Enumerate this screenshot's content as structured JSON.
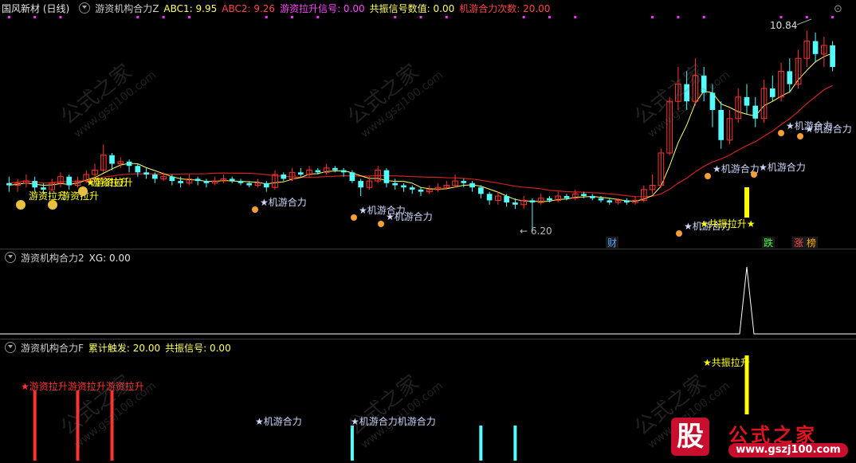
{
  "colors": {
    "up": "#ff3232",
    "down": "#54fcfc",
    "ma5": "#ffff66",
    "ma20": "#cc2222",
    "label_white": "#cfd8ff",
    "label_yellow": "#ffff00",
    "label_red": "#ff3232",
    "magenta": "#ff33ff"
  },
  "main": {
    "stock": "国风新材 (日线)",
    "indicator": "游资机构合力Z",
    "abc1_label": "ABC1: 9.95",
    "abc2_label": "ABC2: 9.26",
    "pull_signal": "游资拉升信号: 0.00",
    "resonance_value": "共振信号数值: 0.00",
    "fund_count": "机游合力次数: 20.00",
    "high_label": "10.84",
    "low_label": "6.20",
    "event_cai": "财",
    "event_die": "跌",
    "event_zhang": "涨",
    "event_bang": "榜",
    "marker_youzi": "游资拉升",
    "marker_jiyou": "★机游合力",
    "marker_gongzhen": "★共振拉升★",
    "marker_youzi_star": "★游资拉升"
  },
  "xg": {
    "indicator": "游资机构合力2",
    "value_label": "XG: 0.00"
  },
  "f": {
    "indicator": "游资机构合力F",
    "cum_label": "累计触发: 20.00",
    "res_label": "共振信号: 0.00",
    "bar_red_label": "★游资拉升游资拉升游资拉升",
    "bar_cyan_label1": "★机游合力",
    "bar_cyan_label2": "★机游合力机游合力",
    "bar_yellow_label": "★共振拉升"
  },
  "watermark": {
    "text": "公式之家",
    "url": "www.gszj100.com"
  },
  "logo": {
    "badge": "股",
    "name": "公式之家",
    "url": "www.gszj100.com"
  },
  "chart_data": {
    "type": "candlestick",
    "ylim": [
      6.0,
      11.0
    ],
    "high_label": 10.84,
    "low_label": 6.2,
    "candles": [
      [
        7.3,
        7.25,
        7.45,
        7.1
      ],
      [
        7.25,
        7.3,
        7.4,
        7.1
      ],
      [
        7.3,
        7.35,
        7.5,
        7.2
      ],
      [
        7.35,
        7.2,
        7.45,
        7.1
      ],
      [
        7.2,
        7.15,
        7.3,
        7.05
      ],
      [
        7.15,
        7.3,
        7.4,
        7.1
      ],
      [
        7.3,
        7.45,
        7.55,
        7.2
      ],
      [
        7.45,
        7.25,
        7.5,
        7.15
      ],
      [
        7.25,
        7.35,
        7.45,
        7.2
      ],
      [
        7.35,
        7.5,
        7.6,
        7.3
      ],
      [
        7.5,
        7.6,
        7.75,
        7.4
      ],
      [
        7.6,
        7.95,
        8.2,
        7.55
      ],
      [
        7.95,
        7.75,
        8.0,
        7.6
      ],
      [
        7.75,
        7.8,
        7.9,
        7.65
      ],
      [
        7.8,
        7.7,
        7.85,
        7.55
      ],
      [
        7.7,
        7.55,
        7.75,
        7.45
      ],
      [
        7.55,
        7.5,
        7.65,
        7.4
      ],
      [
        7.5,
        7.4,
        7.55,
        7.3
      ],
      [
        7.4,
        7.45,
        7.55,
        7.35
      ],
      [
        7.45,
        7.35,
        7.5,
        7.25
      ],
      [
        7.35,
        7.3,
        7.45,
        7.2
      ],
      [
        7.3,
        7.4,
        7.5,
        7.25
      ],
      [
        7.4,
        7.35,
        7.45,
        7.25
      ],
      [
        7.35,
        7.3,
        7.4,
        7.2
      ],
      [
        7.3,
        7.35,
        7.45,
        7.25
      ],
      [
        7.35,
        7.4,
        7.5,
        7.3
      ],
      [
        7.4,
        7.35,
        7.45,
        7.3
      ],
      [
        7.35,
        7.3,
        7.4,
        7.25
      ],
      [
        7.3,
        7.25,
        7.35,
        7.2
      ],
      [
        7.25,
        7.3,
        7.4,
        7.2
      ],
      [
        7.3,
        7.2,
        7.35,
        7.1
      ],
      [
        7.2,
        7.5,
        7.6,
        7.15
      ],
      [
        7.5,
        7.4,
        7.55,
        7.35
      ],
      [
        7.4,
        7.55,
        7.65,
        7.35
      ],
      [
        7.55,
        7.5,
        7.65,
        7.45
      ],
      [
        7.5,
        7.6,
        7.7,
        7.45
      ],
      [
        7.6,
        7.55,
        7.65,
        7.5
      ],
      [
        7.55,
        7.65,
        7.75,
        7.5
      ],
      [
        7.65,
        7.6,
        7.7,
        7.55
      ],
      [
        7.6,
        7.55,
        7.65,
        7.45
      ],
      [
        7.55,
        7.35,
        7.6,
        7.3
      ],
      [
        7.35,
        7.2,
        7.4,
        7.0
      ],
      [
        7.2,
        7.35,
        7.45,
        7.15
      ],
      [
        7.35,
        7.6,
        7.7,
        7.3
      ],
      [
        7.6,
        7.3,
        7.65,
        7.2
      ],
      [
        7.3,
        7.25,
        7.4,
        7.15
      ],
      [
        7.25,
        7.2,
        7.3,
        7.1
      ],
      [
        7.2,
        7.15,
        7.25,
        7.05
      ],
      [
        7.15,
        7.1,
        7.2,
        7.0
      ],
      [
        7.1,
        7.15,
        7.25,
        7.05
      ],
      [
        7.15,
        7.2,
        7.3,
        7.1
      ],
      [
        7.2,
        7.25,
        7.35,
        7.15
      ],
      [
        7.25,
        7.35,
        7.5,
        7.2
      ],
      [
        7.35,
        7.3,
        7.4,
        7.2
      ],
      [
        7.3,
        7.2,
        7.35,
        7.1
      ],
      [
        7.2,
        7.05,
        7.25,
        6.95
      ],
      [
        7.05,
        6.9,
        7.1,
        6.8
      ],
      [
        6.9,
        7.0,
        7.1,
        6.8
      ],
      [
        7.0,
        6.85,
        7.05,
        6.75
      ],
      [
        6.85,
        6.8,
        6.95,
        6.7
      ],
      [
        6.8,
        6.9,
        7.0,
        6.7
      ],
      [
        6.9,
        6.85,
        6.95,
        6.2
      ],
      [
        6.85,
        6.95,
        7.05,
        6.8
      ],
      [
        6.95,
        6.9,
        7.0,
        6.85
      ],
      [
        6.9,
        7.0,
        7.1,
        6.85
      ],
      [
        7.0,
        6.95,
        7.05,
        6.9
      ],
      [
        6.95,
        7.05,
        7.15,
        6.9
      ],
      [
        7.05,
        7.0,
        7.1,
        6.95
      ],
      [
        7.0,
        6.95,
        7.05,
        6.9
      ],
      [
        6.95,
        6.9,
        7.0,
        6.85
      ],
      [
        6.9,
        6.85,
        6.95,
        6.8
      ],
      [
        6.85,
        6.9,
        6.95,
        6.8
      ],
      [
        6.9,
        6.85,
        6.95,
        6.8
      ],
      [
        6.85,
        6.9,
        7.0,
        6.8
      ],
      [
        6.9,
        7.15,
        7.25,
        6.85
      ],
      [
        7.15,
        7.25,
        7.5,
        7.05
      ],
      [
        7.25,
        8.0,
        8.1,
        7.2
      ],
      [
        8.0,
        9.2,
        9.3,
        7.95
      ],
      [
        9.2,
        9.6,
        10.0,
        9.0
      ],
      [
        9.6,
        9.2,
        9.9,
        9.0
      ],
      [
        9.2,
        9.8,
        10.2,
        9.1
      ],
      [
        9.8,
        9.4,
        10.0,
        9.2
      ],
      [
        9.4,
        9.0,
        9.6,
        8.6
      ],
      [
        9.0,
        8.3,
        9.2,
        8.1
      ],
      [
        8.3,
        8.8,
        9.0,
        8.2
      ],
      [
        8.8,
        9.3,
        9.5,
        8.7
      ],
      [
        9.3,
        9.1,
        9.6,
        8.9
      ],
      [
        9.1,
        8.8,
        9.3,
        8.6
      ],
      [
        8.8,
        9.5,
        9.7,
        8.7
      ],
      [
        9.5,
        9.3,
        9.8,
        9.2
      ],
      [
        9.3,
        9.9,
        10.1,
        9.2
      ],
      [
        9.9,
        9.6,
        10.2,
        9.4
      ],
      [
        9.6,
        10.2,
        10.4,
        9.5
      ],
      [
        10.2,
        10.6,
        10.84,
        10.0
      ],
      [
        10.6,
        10.3,
        10.8,
        10.1
      ],
      [
        10.3,
        10.5,
        10.7,
        10.0
      ],
      [
        10.5,
        10.0,
        10.6,
        9.9
      ]
    ],
    "signal_bars": {
      "red": [
        3,
        8,
        12
      ],
      "cyan": [
        40,
        55,
        59
      ],
      "yellow": [
        86
      ]
    },
    "xg_spike_index": 86
  }
}
